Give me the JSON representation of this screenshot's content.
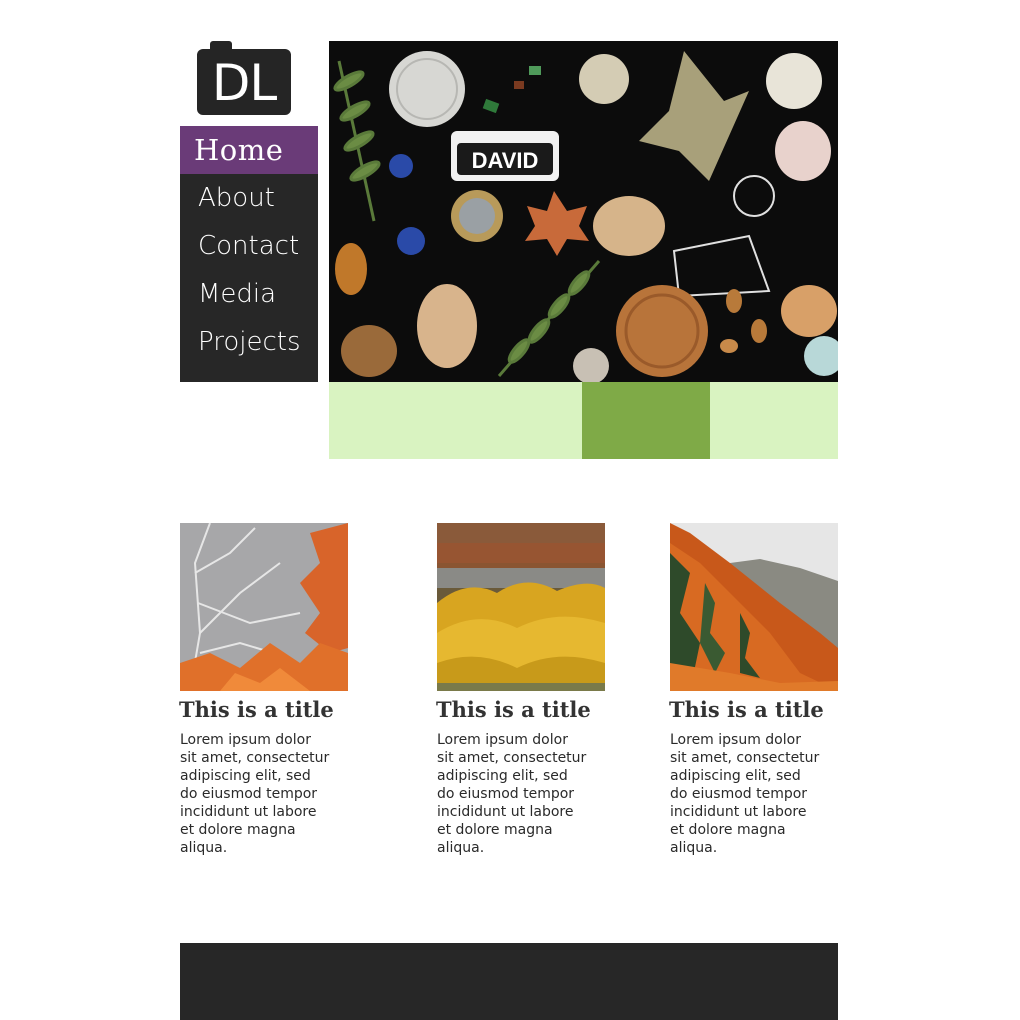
{
  "logo": {
    "text": "DL"
  },
  "nav": {
    "items": [
      {
        "label": "Home",
        "active": true
      },
      {
        "label": "About"
      },
      {
        "label": "Contact"
      },
      {
        "label": "Media"
      },
      {
        "label": "Projects"
      }
    ]
  },
  "hero": {
    "image": "collage-of-objects-on-black"
  },
  "slider": {
    "slides": 4,
    "active_index": 2
  },
  "cards": [
    {
      "title": "This is a title",
      "text": "Lorem ipsum dolor sit amet, consectetur adipiscing elit, sed do eiusmod tempor incididunt ut labore et dolore magna aliqua.",
      "image": "bare-tree-autumn-leaves"
    },
    {
      "title": "This is a title",
      "text": "Lorem ipsum dolor sit amet, consectetur adipiscing elit, sed do eiusmod tempor incididunt ut labore et dolore magna aliqua.",
      "image": "yellow-shrubs"
    },
    {
      "title": "This is a title",
      "text": "Lorem ipsum dolor sit amet, consectetur adipiscing elit, sed do eiusmod tempor incididunt ut labore et dolore magna aliqua.",
      "image": "autumn-mountainside"
    }
  ],
  "colors": {
    "dark": "#272727",
    "accent_purple": "#6a3b78",
    "slider_light": "#d9f3c1",
    "slider_active": "#7faa47"
  }
}
